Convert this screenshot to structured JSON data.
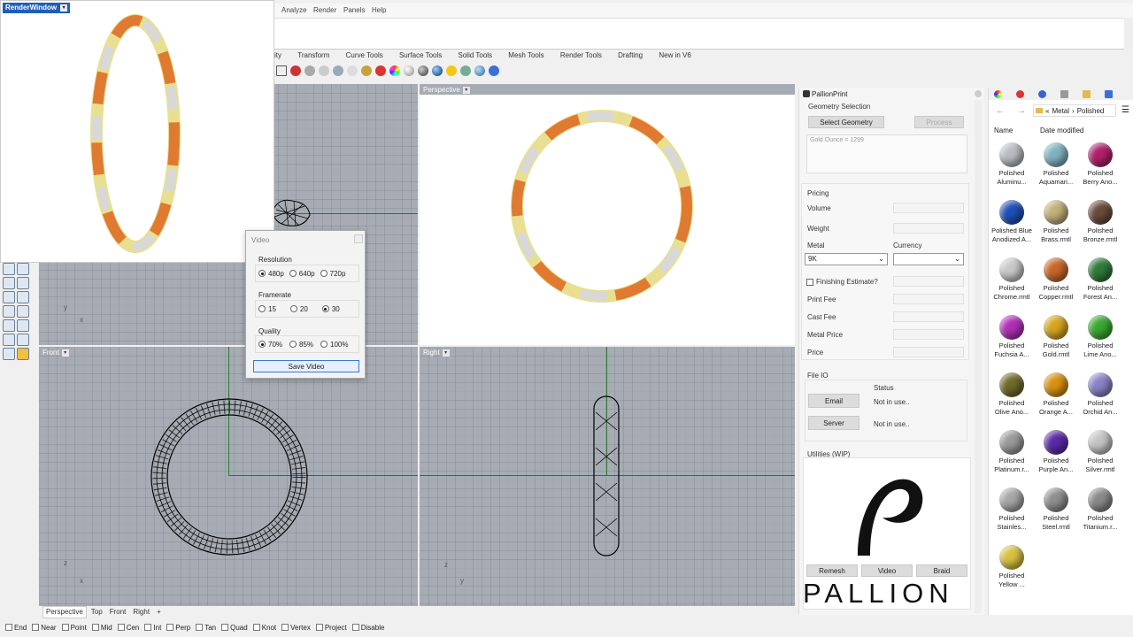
{
  "menu": {
    "items": [
      "Analyze",
      "Render",
      "Panels",
      "Help"
    ]
  },
  "toolbar_tabs": [
    "ity",
    "Transform",
    "Curve Tools",
    "Surface Tools",
    "Solid Tools",
    "Mesh Tools",
    "Render Tools",
    "Drafting",
    "New in V6"
  ],
  "render_window": {
    "title": "RenderWindow"
  },
  "viewports": {
    "perspective": "Perspective",
    "front": "Front",
    "right": "Right"
  },
  "axis_labels": {
    "x": "x",
    "y": "y",
    "z": "z"
  },
  "video_dialog": {
    "title": "Video",
    "resolution_label": "Resolution",
    "resolutions": [
      "480p",
      "640p",
      "720p"
    ],
    "resolution_selected": "480p",
    "framerate_label": "Framerate",
    "framerates": [
      "15",
      "20",
      "30"
    ],
    "framerate_selected": "30",
    "quality_label": "Quality",
    "qualities": [
      "70%",
      "85%",
      "100%"
    ],
    "quality_selected": "70%",
    "save_label": "Save Video"
  },
  "pallion": {
    "title": "PallionPrint",
    "geometry_section": "Geometry Selection",
    "select_geometry": "Select Geometry",
    "process": "Process",
    "list_item": "Gold Ounce = 1299",
    "pricing_section": "Pricing",
    "volume": "Volume",
    "weight": "Weight",
    "metal": "Metal",
    "currency": "Currency",
    "metal_value": "9K",
    "currency_value": "",
    "finishing": "Finishing Estimate?",
    "print_fee": "Print Fee",
    "cast_fee": "Cast Fee",
    "metal_price": "Metal Price",
    "price": "Price",
    "fileio_section": "File IO",
    "status_header": "Status",
    "email": "Email",
    "server": "Server",
    "email_status": "Not in use..",
    "server_status": "Not in use..",
    "utilities_section": "Utilities (WIP)",
    "remesh": "Remesh",
    "video": "Video",
    "braid": "Braid",
    "brand": "PALLION"
  },
  "materials": {
    "breadcrumb_1": "Metal",
    "breadcrumb_2": "Polished",
    "col_name": "Name",
    "col_date": "Date modified",
    "items": [
      {
        "line1": "Polished",
        "line2": "Aluminu...",
        "color": "#b9bcc0"
      },
      {
        "line1": "Polished",
        "line2": "Aquamari...",
        "color": "#7fb2c0"
      },
      {
        "line1": "Polished",
        "line2": "Berry Ano...",
        "color": "#b0206a"
      },
      {
        "line1": "Polished Blue",
        "line2": "Anodized A...",
        "color": "#1f4fb8"
      },
      {
        "line1": "Polished",
        "line2": "Brass.rmtl",
        "color": "#c2b078"
      },
      {
        "line1": "Polished",
        "line2": "Bronze.rmtl",
        "color": "#6b4a3a"
      },
      {
        "line1": "Polished",
        "line2": "Chrome.rmtl",
        "color": "#c8c8c8"
      },
      {
        "line1": "Polished",
        "line2": "Copper.rmtl",
        "color": "#c8662a"
      },
      {
        "line1": "Polished",
        "line2": "Forest An...",
        "color": "#2f7a3a"
      },
      {
        "line1": "Polished",
        "line2": "Fuchsia A...",
        "color": "#b030b8"
      },
      {
        "line1": "Polished",
        "line2": "Gold.rmtl",
        "color": "#d6a520"
      },
      {
        "line1": "Polished",
        "line2": "Lime Ano...",
        "color": "#3aa830"
      },
      {
        "line1": "Polished",
        "line2": "Olive Ano...",
        "color": "#6f6a2a"
      },
      {
        "line1": "Polished",
        "line2": "Orange A...",
        "color": "#d89010"
      },
      {
        "line1": "Polished",
        "line2": "Orchid An...",
        "color": "#8a82c8"
      },
      {
        "line1": "Polished",
        "line2": "Platinum.r...",
        "color": "#9a9a9a"
      },
      {
        "line1": "Polished",
        "line2": "Purple An...",
        "color": "#5a2aa8"
      },
      {
        "line1": "Polished",
        "line2": "Silver.rmtl",
        "color": "#c4c4c4"
      },
      {
        "line1": "Polished",
        "line2": "Stainles...",
        "color": "#a6a6a6"
      },
      {
        "line1": "Polished",
        "line2": "Steel.rmtl",
        "color": "#8e8e8e"
      },
      {
        "line1": "Polished",
        "line2": "Titanium.r...",
        "color": "#8a8a8a"
      },
      {
        "line1": "Polished",
        "line2": "Yellow ...",
        "color": "#d8c040"
      }
    ]
  },
  "view_tabs": [
    "Perspective",
    "Top",
    "Front",
    "Right"
  ],
  "osnaps": [
    "End",
    "Near",
    "Point",
    "Mid",
    "Cen",
    "Int",
    "Perp",
    "Tan",
    "Quad",
    "Knot",
    "Vertex",
    "Project",
    "Disable"
  ]
}
